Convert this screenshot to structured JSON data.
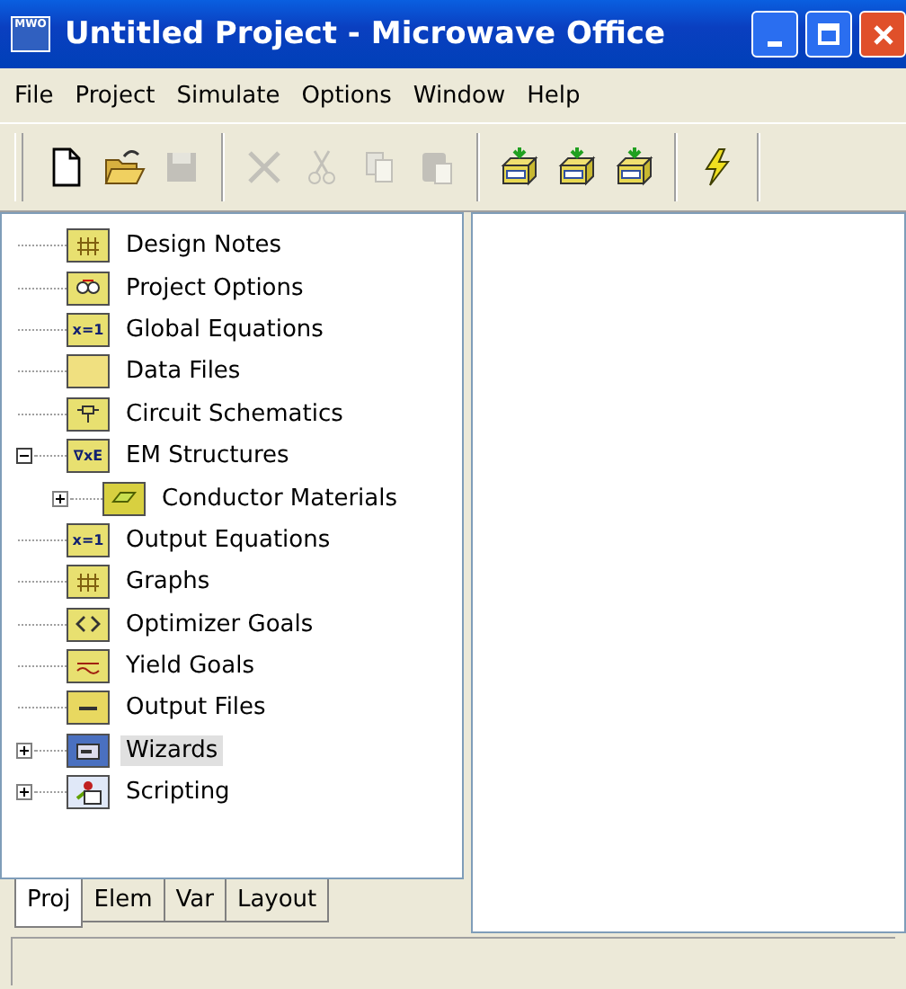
{
  "window": {
    "title": "Untitled Project - Microwave Office",
    "logo_text": "MWO"
  },
  "menu": [
    "File",
    "Project",
    "Simulate",
    "Options",
    "Window",
    "Help"
  ],
  "toolbar": [
    [
      {
        "kind": "new",
        "disabled": false
      },
      {
        "kind": "open",
        "disabled": false
      },
      {
        "kind": "save",
        "disabled": true
      }
    ],
    [
      {
        "kind": "delete",
        "disabled": true
      },
      {
        "kind": "cut",
        "disabled": true
      },
      {
        "kind": "copy",
        "disabled": true
      },
      {
        "kind": "paste",
        "disabled": true
      }
    ],
    [
      {
        "kind": "add-schematic",
        "disabled": false
      },
      {
        "kind": "add-em",
        "disabled": false
      },
      {
        "kind": "add-graph",
        "disabled": false
      }
    ],
    [
      {
        "kind": "simulate",
        "disabled": false
      }
    ]
  ],
  "tree": [
    {
      "label": "Design Notes",
      "kind": "notes",
      "selected": false
    },
    {
      "label": "Project Options",
      "kind": "options",
      "selected": false
    },
    {
      "label": "Global Equations",
      "kind": "equation",
      "badge": "x=1",
      "selected": false
    },
    {
      "label": "Data Files",
      "kind": "folder",
      "selected": false
    },
    {
      "label": "Circuit Schematics",
      "kind": "schematic",
      "selected": false
    },
    {
      "label": "EM Structures",
      "kind": "equation",
      "badge": "∇xE",
      "expanded": true,
      "selected": false,
      "children": [
        {
          "label": "Conductor Materials",
          "kind": "conductor",
          "expanded": false,
          "selected": false
        }
      ]
    },
    {
      "label": "Output Equations",
      "kind": "equation",
      "badge": "x=1",
      "selected": false
    },
    {
      "label": "Graphs",
      "kind": "graph",
      "selected": false
    },
    {
      "label": "Optimizer Goals",
      "kind": "goals",
      "selected": false
    },
    {
      "label": "Yield Goals",
      "kind": "yield",
      "selected": false
    },
    {
      "label": "Output Files",
      "kind": "files",
      "selected": false
    },
    {
      "label": "Wizards",
      "kind": "wizard",
      "expanded": false,
      "selected": true
    },
    {
      "label": "Scripting",
      "kind": "script",
      "expanded": false,
      "selected": false
    }
  ],
  "tabs": [
    {
      "label": "Proj",
      "selected": true
    },
    {
      "label": "Elem",
      "selected": false
    },
    {
      "label": "Var",
      "selected": false
    },
    {
      "label": "Layout",
      "selected": false
    }
  ]
}
